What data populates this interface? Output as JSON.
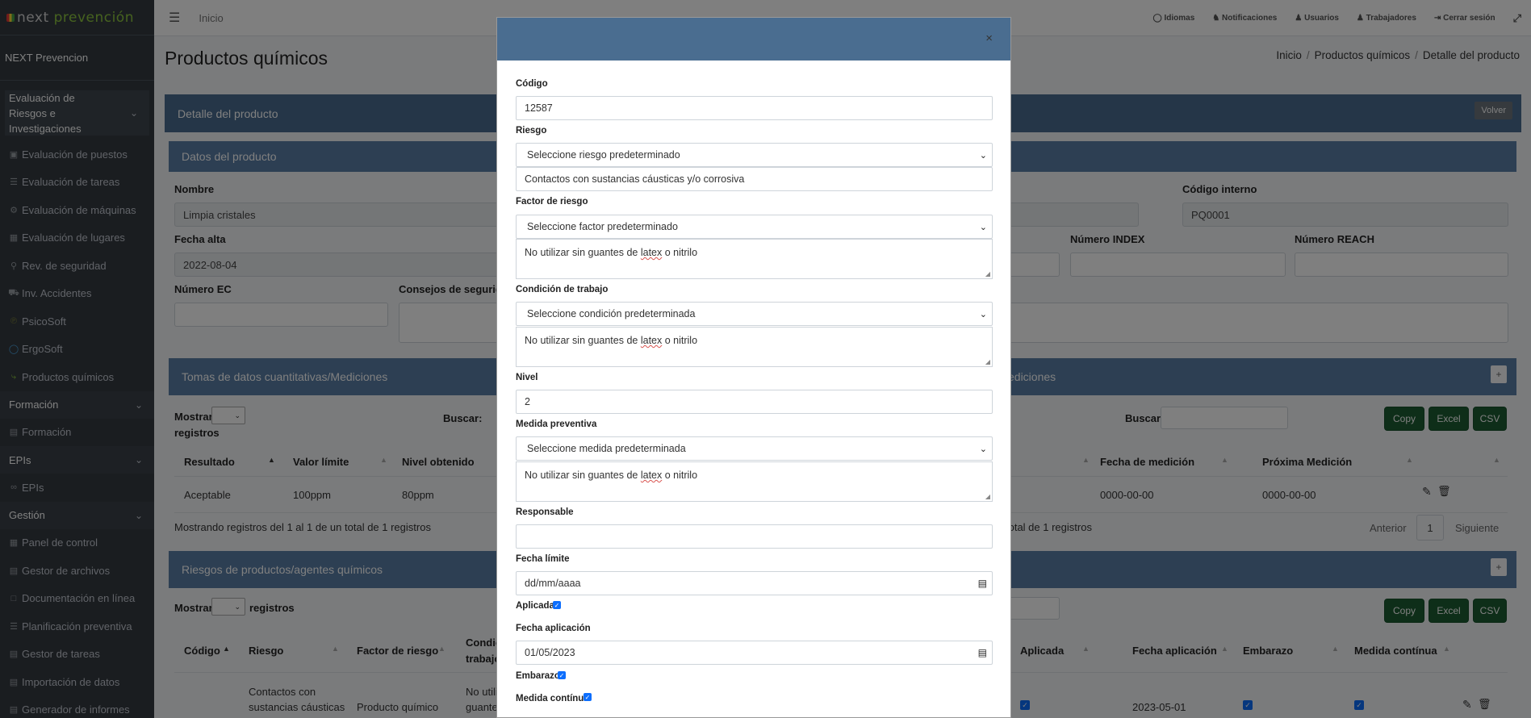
{
  "brand": {
    "name_a": "next",
    "name_b": "prevención"
  },
  "user": "NEXT Prevencion",
  "topbar": {
    "home": "Inicio",
    "items": [
      "Idiomas",
      "Notificaciones",
      "Usuarios",
      "Trabajadores",
      "Cerrar sesión"
    ]
  },
  "sidebar": {
    "group1": "Evaluación de Riesgos e Investigaciones",
    "group1_items": [
      "Evaluación de puestos",
      "Evaluación de tareas",
      "Evaluación de máquinas",
      "Evaluación de lugares",
      "Rev. de seguridad",
      "Inv. Accidentes",
      "PsicoSoft",
      "ErgoSoft",
      "Productos químicos"
    ],
    "group2": "Formación",
    "group2_items": [
      "Formación"
    ],
    "group3": "EPIs",
    "group3_items": [
      "EPIs"
    ],
    "group4": "Gestión",
    "group4_items": [
      "Panel de control",
      "Gestor de archivos",
      "Documentación en línea",
      "Planificación preventiva",
      "Gestor de tareas",
      "Importación de datos",
      "Generador de informes"
    ]
  },
  "page": {
    "title": "Productos químicos",
    "breadcrumb": [
      "Inicio",
      "Productos químicos",
      "Detalle del producto"
    ],
    "card_title": "Detalle del producto",
    "back_button": "Volver",
    "datos_title": "Datos del producto",
    "nombre_label": "Nombre",
    "nombre_value": "Limpia cristales",
    "codigo_interno_label": "Código interno",
    "codigo_interno_value": "PQ0001",
    "fecha_alta_label": "Fecha alta",
    "fecha_alta_value": "2022-08-04",
    "numero_index_label": "Número INDEX",
    "numero_reach_label": "Número REACH",
    "numero_ec_label": "Número EC",
    "consejos_label": "Consejos de segurida",
    "obs_label_partial": "nes"
  },
  "mediciones": {
    "title": "Tomas de datos cuantitativas/Mediciones",
    "title_right": "ediciones",
    "show_label": "Mostrar",
    "records_label": "registros",
    "search_label": "Buscar:",
    "buttons": [
      "Copy",
      "Excel",
      "CSV"
    ],
    "headers": [
      "Resultado",
      "Valor límite",
      "Nivel obtenido",
      "Fecha de medición",
      "Próxima Medición"
    ],
    "row": [
      "Aceptable",
      "100ppm",
      "80ppm",
      "0000-00-00",
      "0000-00-00"
    ],
    "info": "Mostrando registros del 1 al 1 de un total de 1 registros",
    "info_right": "total de 1 registros",
    "pager": [
      "Anterior",
      "1",
      "Siguiente"
    ]
  },
  "riesgos": {
    "title": "Riesgos de productos/agentes químicos",
    "show_label": "Mostrar",
    "records_label": "registros",
    "buttons": [
      "Copy",
      "Excel",
      "CSV"
    ],
    "headers": [
      "Código",
      "Riesgo",
      "Factor de riesgo",
      "Condic",
      "trabajo",
      "Aplicada",
      "Fecha aplicación",
      "Embarazo",
      "Medida contínua"
    ],
    "row": {
      "riesgo_line1": "Contactos con",
      "riesgo_line2": "sustancias cáusticas",
      "factor": "Producto químico",
      "cond_line1": "No utiliz",
      "cond_line2": "guante",
      "fecha": "2023-05-01"
    }
  },
  "modal": {
    "close": "×",
    "codigo_label": "Código",
    "codigo_value": "12587",
    "riesgo_label": "Riesgo",
    "riesgo_select": "Seleccione riesgo predeterminado",
    "riesgo_value": "Contactos con sustancias cáusticas y/o corrosiva",
    "factor_label": "Factor de riesgo",
    "factor_select": "Seleccione factor predeterminado",
    "factor_text_a": "No utilizar sin guantes de ",
    "factor_text_u": "latex",
    "factor_text_b": " o nitrilo",
    "condicion_label": "Condición de trabajo",
    "condicion_select": "Seleccione condición predeterminada",
    "condicion_text_a": "No utilizar sin guantes de ",
    "condicion_text_u": "latex",
    "condicion_text_b": " o nitrilo",
    "nivel_label": "Nivel",
    "nivel_value": "2",
    "medida_label": "Medida preventiva",
    "medida_select": "Seleccione medida predeterminada",
    "medida_text_a": "No utilizar sin guantes de ",
    "medida_text_u": "latex",
    "medida_text_b": " o nitrilo",
    "responsable_label": "Responsable",
    "responsable_value": "",
    "fecha_limite_label": "Fecha límite",
    "fecha_limite_value": "dd/mm/aaaa",
    "aplicada_label": "Aplicada",
    "aplicada_checked": true,
    "fecha_aplicacion_label": "Fecha aplicación",
    "fecha_aplicacion_value": "01/05/2023",
    "embarazo_label": "Embarazo",
    "embarazo_checked": true,
    "medida_continua_label": "Medida contínua",
    "medida_continua_checked": true
  }
}
